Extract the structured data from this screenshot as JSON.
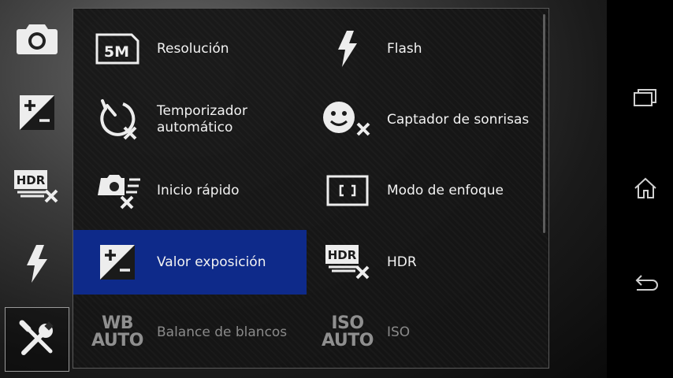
{
  "sidebar": {
    "buttons": [
      {
        "icon": "camera-icon"
      },
      {
        "icon": "exposure-icon"
      },
      {
        "icon": "hdr-off-icon"
      },
      {
        "icon": "flash-icon"
      },
      {
        "icon": "settings-tools-icon",
        "selected": true
      }
    ]
  },
  "menu": {
    "items": [
      {
        "label": "Resolución",
        "icon": "resolution-5m-icon",
        "icon_text": "5M"
      },
      {
        "label": "Flash",
        "icon": "flash-icon"
      },
      {
        "label": "Temporizador automático",
        "icon": "self-timer-off-icon"
      },
      {
        "label": "Captador de sonrisas",
        "icon": "smile-shutter-off-icon"
      },
      {
        "label": "Inicio rápido",
        "icon": "quick-launch-off-icon"
      },
      {
        "label": "Modo de enfoque",
        "icon": "focus-mode-icon"
      },
      {
        "label": "Valor exposición",
        "icon": "exposure-icon",
        "selected": true
      },
      {
        "label": "HDR",
        "icon": "hdr-off-icon",
        "icon_text": "HDR"
      },
      {
        "label": "Balance de blancos",
        "icon": "white-balance-auto-icon",
        "icon_text_1": "WB",
        "icon_text_2": "AUTO",
        "disabled": true
      },
      {
        "label": "ISO",
        "icon": "iso-auto-icon",
        "icon_text_1": "ISO",
        "icon_text_2": "AUTO",
        "disabled": true
      }
    ]
  },
  "navbar": {
    "buttons": [
      {
        "icon": "recent-apps-icon"
      },
      {
        "icon": "home-icon"
      },
      {
        "icon": "back-icon"
      }
    ]
  },
  "colors": {
    "selected_bg": "#0e2a8a",
    "text": "#f2f2f2",
    "disabled_text": "#8a8a8a"
  }
}
